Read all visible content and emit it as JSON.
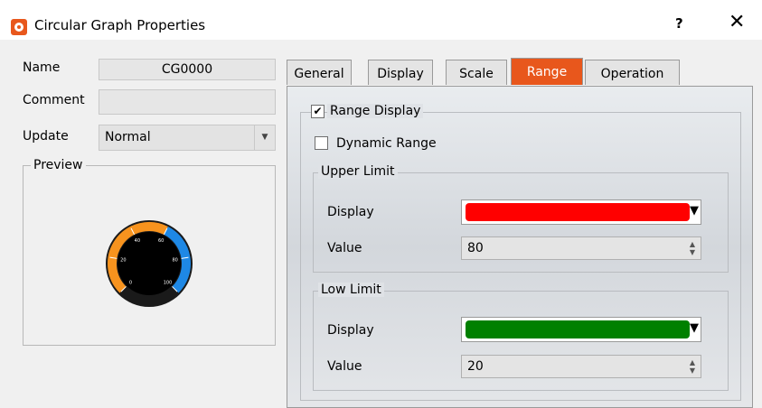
{
  "window": {
    "title": "Circular Graph Properties",
    "help": "?",
    "close": "✕"
  },
  "form": {
    "name_label": "Name",
    "name_value": "CG0000",
    "comment_label": "Comment",
    "comment_value": "",
    "update_label": "Update",
    "update_value": "Normal",
    "preview_label": "Preview"
  },
  "gauge": {
    "ticks": [
      "0",
      "20",
      "40",
      "60",
      "80",
      "100"
    ],
    "low_color": "#f7931e",
    "high_color": "#1e88e5"
  },
  "tabs": [
    "General",
    "Display",
    "Scale",
    "Range",
    "Operation"
  ],
  "active_tab": "Range",
  "range": {
    "range_display_label": "Range Display",
    "range_display_checked": true,
    "dynamic_range_label": "Dynamic Range",
    "dynamic_range_checked": false,
    "upper": {
      "title": "Upper Limit",
      "display_label": "Display",
      "color": "#ff0000",
      "value_label": "Value",
      "value": "80"
    },
    "low": {
      "title": "Low Limit",
      "display_label": "Display",
      "color": "#008000",
      "value_label": "Value",
      "value": "20"
    }
  }
}
